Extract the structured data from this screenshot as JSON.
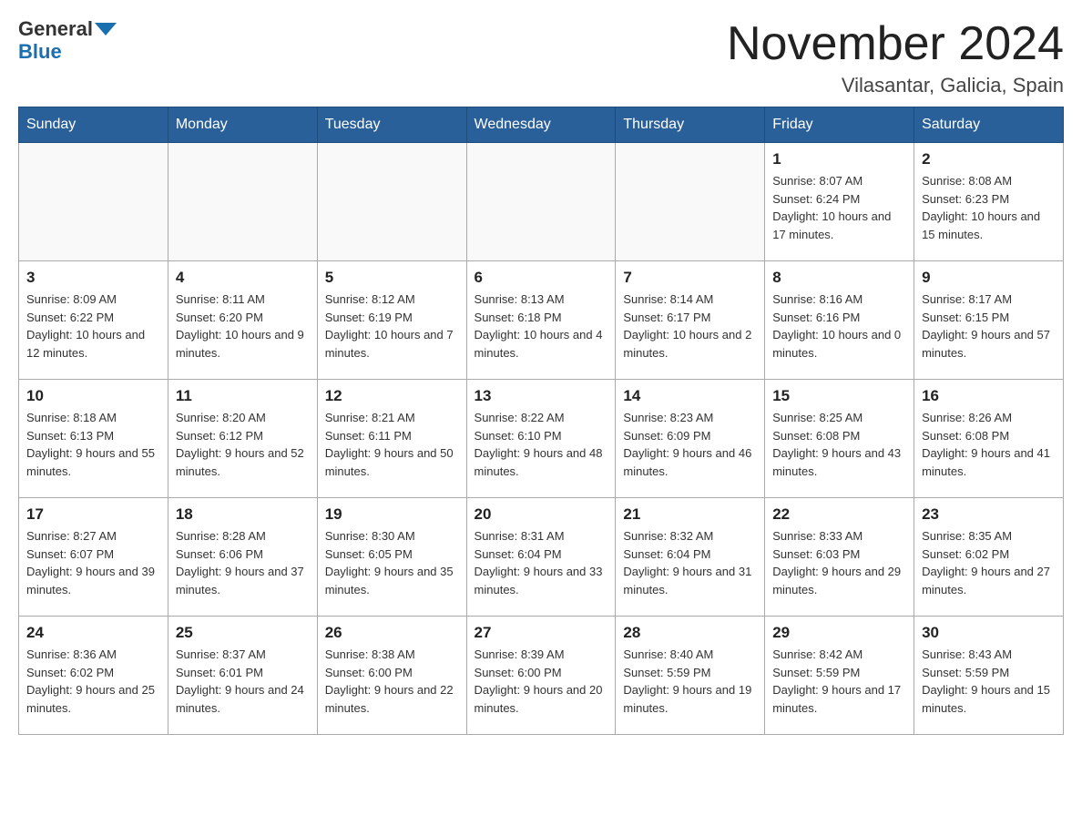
{
  "header": {
    "logo_line1": "General",
    "logo_line2": "Blue",
    "month_title": "November 2024",
    "location": "Vilasantar, Galicia, Spain"
  },
  "weekdays": [
    "Sunday",
    "Monday",
    "Tuesday",
    "Wednesday",
    "Thursday",
    "Friday",
    "Saturday"
  ],
  "weeks": [
    [
      {
        "day": "",
        "info": ""
      },
      {
        "day": "",
        "info": ""
      },
      {
        "day": "",
        "info": ""
      },
      {
        "day": "",
        "info": ""
      },
      {
        "day": "",
        "info": ""
      },
      {
        "day": "1",
        "info": "Sunrise: 8:07 AM\nSunset: 6:24 PM\nDaylight: 10 hours and 17 minutes."
      },
      {
        "day": "2",
        "info": "Sunrise: 8:08 AM\nSunset: 6:23 PM\nDaylight: 10 hours and 15 minutes."
      }
    ],
    [
      {
        "day": "3",
        "info": "Sunrise: 8:09 AM\nSunset: 6:22 PM\nDaylight: 10 hours and 12 minutes."
      },
      {
        "day": "4",
        "info": "Sunrise: 8:11 AM\nSunset: 6:20 PM\nDaylight: 10 hours and 9 minutes."
      },
      {
        "day": "5",
        "info": "Sunrise: 8:12 AM\nSunset: 6:19 PM\nDaylight: 10 hours and 7 minutes."
      },
      {
        "day": "6",
        "info": "Sunrise: 8:13 AM\nSunset: 6:18 PM\nDaylight: 10 hours and 4 minutes."
      },
      {
        "day": "7",
        "info": "Sunrise: 8:14 AM\nSunset: 6:17 PM\nDaylight: 10 hours and 2 minutes."
      },
      {
        "day": "8",
        "info": "Sunrise: 8:16 AM\nSunset: 6:16 PM\nDaylight: 10 hours and 0 minutes."
      },
      {
        "day": "9",
        "info": "Sunrise: 8:17 AM\nSunset: 6:15 PM\nDaylight: 9 hours and 57 minutes."
      }
    ],
    [
      {
        "day": "10",
        "info": "Sunrise: 8:18 AM\nSunset: 6:13 PM\nDaylight: 9 hours and 55 minutes."
      },
      {
        "day": "11",
        "info": "Sunrise: 8:20 AM\nSunset: 6:12 PM\nDaylight: 9 hours and 52 minutes."
      },
      {
        "day": "12",
        "info": "Sunrise: 8:21 AM\nSunset: 6:11 PM\nDaylight: 9 hours and 50 minutes."
      },
      {
        "day": "13",
        "info": "Sunrise: 8:22 AM\nSunset: 6:10 PM\nDaylight: 9 hours and 48 minutes."
      },
      {
        "day": "14",
        "info": "Sunrise: 8:23 AM\nSunset: 6:09 PM\nDaylight: 9 hours and 46 minutes."
      },
      {
        "day": "15",
        "info": "Sunrise: 8:25 AM\nSunset: 6:08 PM\nDaylight: 9 hours and 43 minutes."
      },
      {
        "day": "16",
        "info": "Sunrise: 8:26 AM\nSunset: 6:08 PM\nDaylight: 9 hours and 41 minutes."
      }
    ],
    [
      {
        "day": "17",
        "info": "Sunrise: 8:27 AM\nSunset: 6:07 PM\nDaylight: 9 hours and 39 minutes."
      },
      {
        "day": "18",
        "info": "Sunrise: 8:28 AM\nSunset: 6:06 PM\nDaylight: 9 hours and 37 minutes."
      },
      {
        "day": "19",
        "info": "Sunrise: 8:30 AM\nSunset: 6:05 PM\nDaylight: 9 hours and 35 minutes."
      },
      {
        "day": "20",
        "info": "Sunrise: 8:31 AM\nSunset: 6:04 PM\nDaylight: 9 hours and 33 minutes."
      },
      {
        "day": "21",
        "info": "Sunrise: 8:32 AM\nSunset: 6:04 PM\nDaylight: 9 hours and 31 minutes."
      },
      {
        "day": "22",
        "info": "Sunrise: 8:33 AM\nSunset: 6:03 PM\nDaylight: 9 hours and 29 minutes."
      },
      {
        "day": "23",
        "info": "Sunrise: 8:35 AM\nSunset: 6:02 PM\nDaylight: 9 hours and 27 minutes."
      }
    ],
    [
      {
        "day": "24",
        "info": "Sunrise: 8:36 AM\nSunset: 6:02 PM\nDaylight: 9 hours and 25 minutes."
      },
      {
        "day": "25",
        "info": "Sunrise: 8:37 AM\nSunset: 6:01 PM\nDaylight: 9 hours and 24 minutes."
      },
      {
        "day": "26",
        "info": "Sunrise: 8:38 AM\nSunset: 6:00 PM\nDaylight: 9 hours and 22 minutes."
      },
      {
        "day": "27",
        "info": "Sunrise: 8:39 AM\nSunset: 6:00 PM\nDaylight: 9 hours and 20 minutes."
      },
      {
        "day": "28",
        "info": "Sunrise: 8:40 AM\nSunset: 5:59 PM\nDaylight: 9 hours and 19 minutes."
      },
      {
        "day": "29",
        "info": "Sunrise: 8:42 AM\nSunset: 5:59 PM\nDaylight: 9 hours and 17 minutes."
      },
      {
        "day": "30",
        "info": "Sunrise: 8:43 AM\nSunset: 5:59 PM\nDaylight: 9 hours and 15 minutes."
      }
    ]
  ]
}
